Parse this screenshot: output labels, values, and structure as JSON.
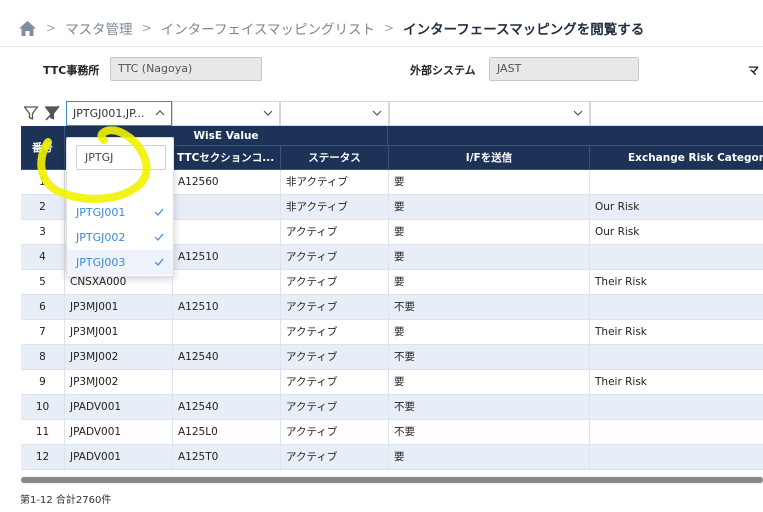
{
  "breadcrumb": {
    "home_icon": "home-icon",
    "items": [
      "マスタ管理",
      "インターフェイスマッピングリスト",
      "インターフェースマッピングを閲覧する"
    ]
  },
  "form": {
    "office_label": "TTC事務所",
    "office_value": "TTC (Nagoya)",
    "external_label": "外部システム",
    "external_value": "JAST",
    "cut_label": "マ"
  },
  "filters": {
    "col1_value": "JPTGJ001,JP...",
    "col2_value": "",
    "col3_value": "",
    "col4_value": "",
    "col5_value": ""
  },
  "table": {
    "group_header": "WisE Value",
    "headers": {
      "num": "番号",
      "section": "TTCセクションコ...",
      "status": "ステータス",
      "send": "I/Fを送信",
      "risk": "Exchange Risk Category"
    },
    "rows": [
      {
        "num": "1",
        "code": "",
        "section": "A12560",
        "status": "非アクティブ",
        "send": "要",
        "risk": ""
      },
      {
        "num": "2",
        "code": "",
        "section": "",
        "status": "非アクティブ",
        "send": "要",
        "risk": "Our Risk"
      },
      {
        "num": "3",
        "code": "",
        "section": "",
        "status": "アクティブ",
        "send": "要",
        "risk": "Our Risk"
      },
      {
        "num": "4",
        "code": "",
        "section": "A12510",
        "status": "アクティブ",
        "send": "要",
        "risk": ""
      },
      {
        "num": "5",
        "code": "CNSXA000",
        "section": "",
        "status": "アクティブ",
        "send": "要",
        "risk": "Their Risk"
      },
      {
        "num": "6",
        "code": "JP3MJ001",
        "section": "A12510",
        "status": "アクティブ",
        "send": "不要",
        "risk": ""
      },
      {
        "num": "7",
        "code": "JP3MJ001",
        "section": "",
        "status": "アクティブ",
        "send": "要",
        "risk": "Their Risk"
      },
      {
        "num": "8",
        "code": "JP3MJ002",
        "section": "A12540",
        "status": "アクティブ",
        "send": "不要",
        "risk": ""
      },
      {
        "num": "9",
        "code": "JP3MJ002",
        "section": "",
        "status": "アクティブ",
        "send": "要",
        "risk": "Their Risk"
      },
      {
        "num": "10",
        "code": "JPADV001",
        "section": "A12540",
        "status": "アクティブ",
        "send": "不要",
        "risk": ""
      },
      {
        "num": "11",
        "code": "JPADV001",
        "section": "A125L0",
        "status": "アクティブ",
        "send": "不要",
        "risk": ""
      },
      {
        "num": "12",
        "code": "JPADV001",
        "section": "A125T0",
        "status": "アクティブ",
        "send": "要",
        "risk": ""
      }
    ]
  },
  "dropdown": {
    "search_value": "JPTGJ",
    "options": [
      "JPTGJ001",
      "JPTGJ002",
      "JPTGJ003"
    ]
  },
  "footer": {
    "summary": "第1-12 合計2760件"
  },
  "colors": {
    "header_bg": "#1c3257",
    "row_alt": "#e8eef8",
    "accent": "#3d88d6",
    "highlighter": "#f2f200"
  }
}
